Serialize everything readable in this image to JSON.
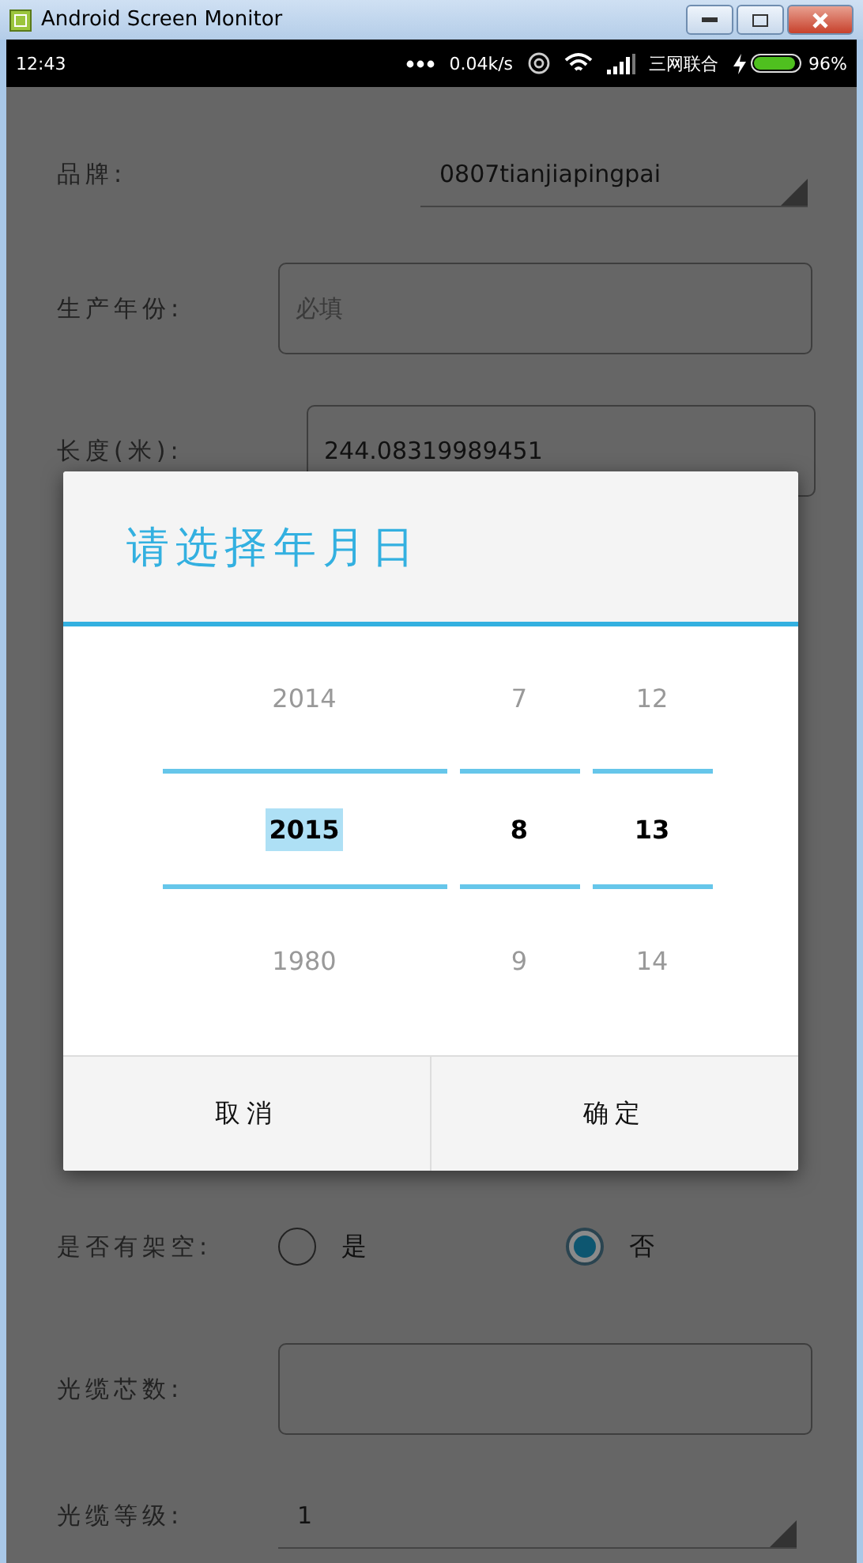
{
  "window": {
    "title": "Android Screen Monitor"
  },
  "status_bar": {
    "time": "12:43",
    "net_speed": "0.04k/s",
    "carrier": "三网联合",
    "battery": "96%"
  },
  "form": [
    {
      "kind": "dropdown",
      "label": "品牌:",
      "value": "0807tianjiapingpai"
    },
    {
      "kind": "field",
      "label": "生产年份:",
      "placeholder": "必填"
    },
    {
      "kind": "field",
      "label": "长度(米):",
      "value": "244.08319989451"
    },
    {
      "kind": "gap"
    },
    {
      "kind": "radio",
      "label": "是否有架空:",
      "options": [
        {
          "label": "是",
          "selected": false
        },
        {
          "label": "否",
          "selected": true
        }
      ]
    },
    {
      "kind": "field",
      "label": "光缆芯数:"
    },
    {
      "kind": "dropdown",
      "label": "光缆等级:",
      "value": "1"
    }
  ],
  "dialog": {
    "title": "请选择年月日",
    "columns": [
      {
        "items": [
          {
            "text": "2014",
            "selected": false
          },
          {
            "text": "2015",
            "selected": true
          },
          {
            "text": "1980",
            "selected": false
          }
        ]
      },
      {
        "items": [
          {
            "text": "7",
            "selected": false
          },
          {
            "text": "8",
            "selected": true
          },
          {
            "text": "9",
            "selected": false
          }
        ]
      },
      {
        "items": [
          {
            "text": "12",
            "selected": false
          },
          {
            "text": "13",
            "selected": true
          },
          {
            "text": "14",
            "selected": false
          }
        ]
      }
    ],
    "buttons": [
      "取消",
      "确定"
    ]
  }
}
